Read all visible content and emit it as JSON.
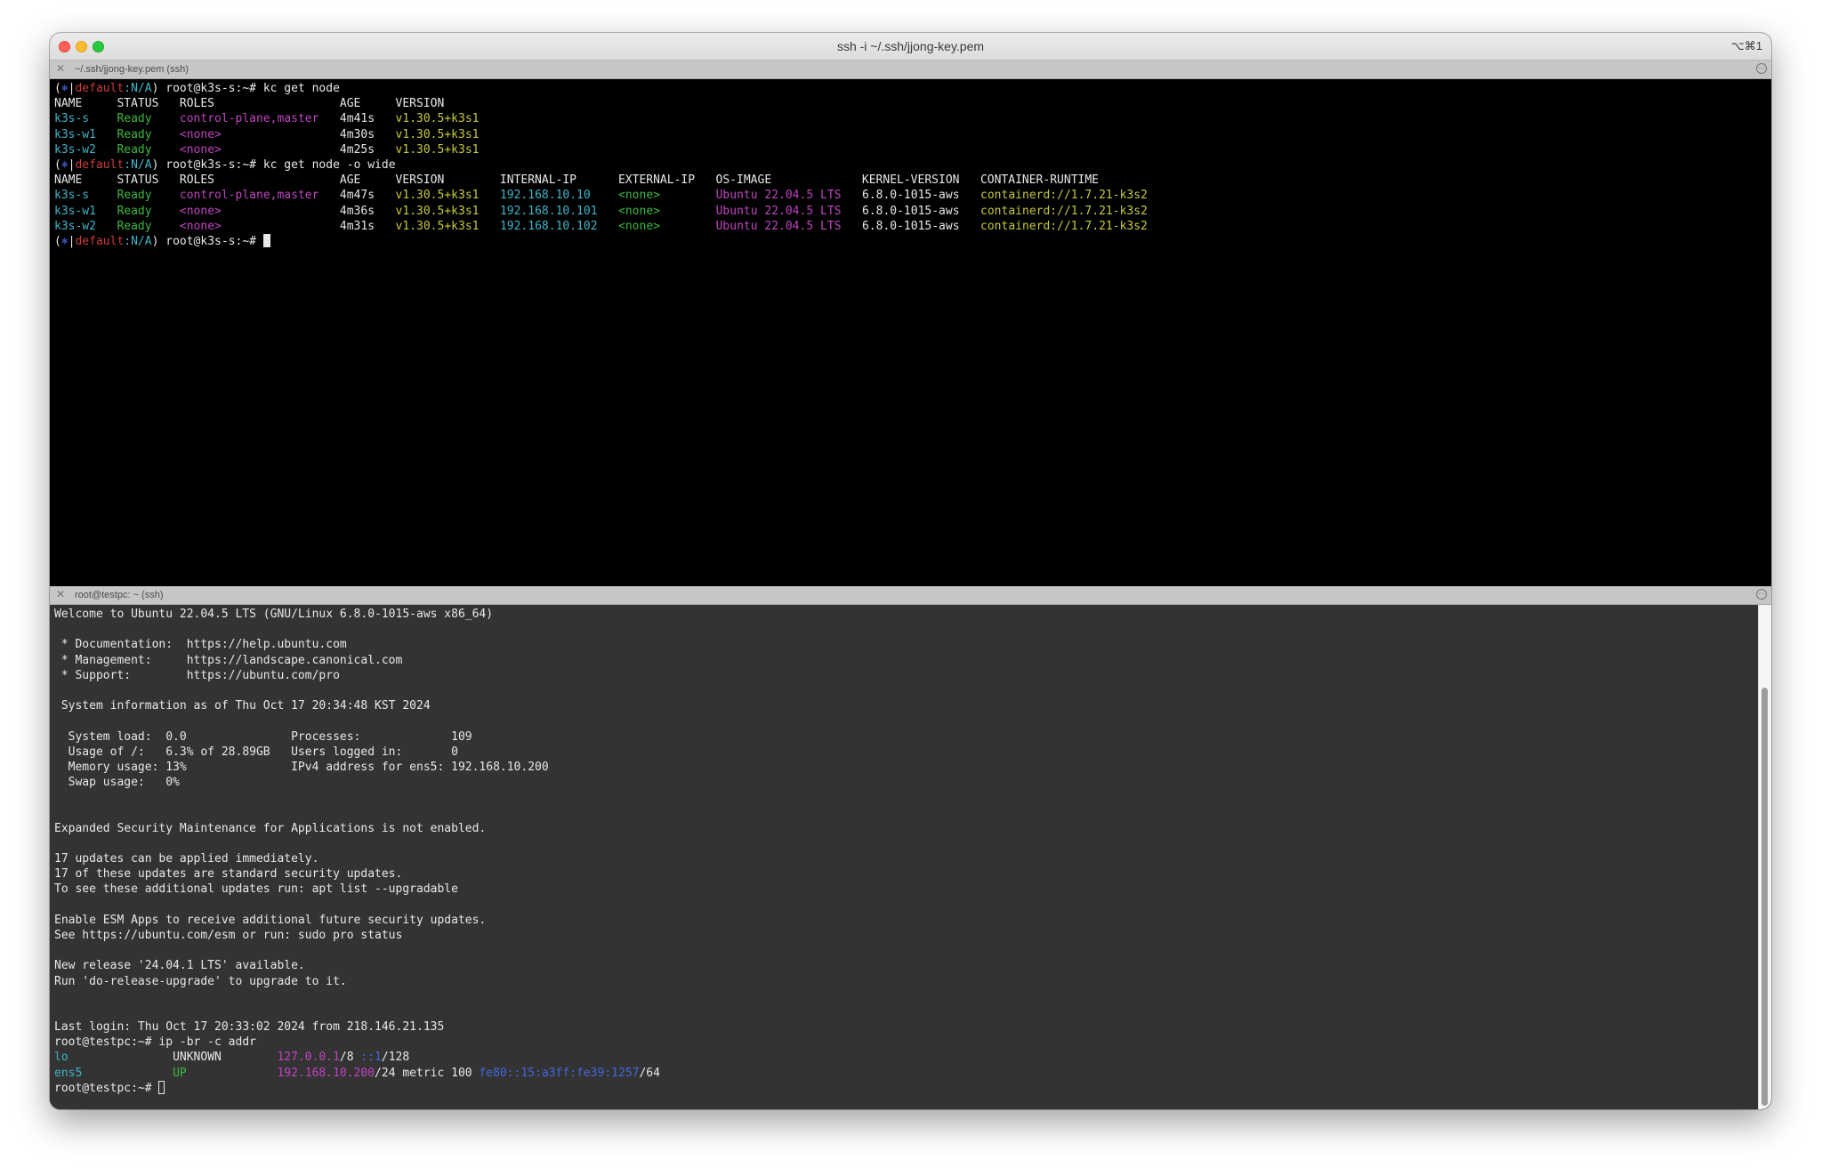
{
  "window": {
    "title": "ssh -i ~/.ssh/jjong-key.pem",
    "shortcut": "⌥⌘1"
  },
  "icons": [
    "close-icon",
    "pane-menu-icon"
  ],
  "colors": {
    "cyan": "#40b4c8",
    "green": "#3db83d",
    "magenta": "#c044c0",
    "yellow": "#c8c83c",
    "red": "#cc3b3b",
    "blue": "#4466dd",
    "white": "#e8e8e8"
  },
  "top_pane": {
    "title": "~/.ssh/jjong-key.pem (ssh)",
    "lines": [
      [
        {
          "t": "(",
          "c": "white"
        },
        {
          "t": "⎈",
          "c": "blue"
        },
        {
          "t": "|",
          "c": "white"
        },
        {
          "t": "default",
          "c": "red"
        },
        {
          "t": ":N/A",
          "c": "cyan"
        },
        {
          "t": ") root@k3s-s:~# kc get node",
          "c": "white"
        }
      ],
      [
        {
          "t": "NAME     STATUS   ROLES                  AGE     VERSION",
          "c": "white"
        }
      ],
      [
        {
          "t": "k3s-s    ",
          "c": "cyan"
        },
        {
          "t": "Ready    ",
          "c": "green"
        },
        {
          "t": "control-plane,master   ",
          "c": "magenta"
        },
        {
          "t": "4m41s   ",
          "c": "white"
        },
        {
          "t": "v1.30.5+k3s1",
          "c": "yellow"
        }
      ],
      [
        {
          "t": "k3s-w1   ",
          "c": "cyan"
        },
        {
          "t": "Ready    ",
          "c": "green"
        },
        {
          "t": "<none>                 ",
          "c": "magenta"
        },
        {
          "t": "4m30s   ",
          "c": "white"
        },
        {
          "t": "v1.30.5+k3s1",
          "c": "yellow"
        }
      ],
      [
        {
          "t": "k3s-w2   ",
          "c": "cyan"
        },
        {
          "t": "Ready    ",
          "c": "green"
        },
        {
          "t": "<none>                 ",
          "c": "magenta"
        },
        {
          "t": "4m25s   ",
          "c": "white"
        },
        {
          "t": "v1.30.5+k3s1",
          "c": "yellow"
        }
      ],
      [
        {
          "t": "(",
          "c": "white"
        },
        {
          "t": "⎈",
          "c": "blue"
        },
        {
          "t": "|",
          "c": "white"
        },
        {
          "t": "default",
          "c": "red"
        },
        {
          "t": ":N/A",
          "c": "cyan"
        },
        {
          "t": ") root@k3s-s:~# kc get node -o wide",
          "c": "white"
        }
      ],
      [
        {
          "t": "NAME     STATUS   ROLES                  AGE     VERSION        INTERNAL-IP      EXTERNAL-IP   OS-IMAGE             KERNEL-VERSION   CONTAINER-RUNTIME",
          "c": "white"
        }
      ],
      [
        {
          "t": "k3s-s    ",
          "c": "cyan"
        },
        {
          "t": "Ready    ",
          "c": "green"
        },
        {
          "t": "control-plane,master   ",
          "c": "magenta"
        },
        {
          "t": "4m47s   ",
          "c": "white"
        },
        {
          "t": "v1.30.5+k3s1   ",
          "c": "yellow"
        },
        {
          "t": "192.168.10.10    ",
          "c": "cyan"
        },
        {
          "t": "<none>        ",
          "c": "green"
        },
        {
          "t": "Ubuntu 22.04.5 LTS   ",
          "c": "magenta"
        },
        {
          "t": "6.8.0-1015-aws   ",
          "c": "white"
        },
        {
          "t": "containerd://1.7.21-k3s2",
          "c": "yellow"
        }
      ],
      [
        {
          "t": "k3s-w1   ",
          "c": "cyan"
        },
        {
          "t": "Ready    ",
          "c": "green"
        },
        {
          "t": "<none>                 ",
          "c": "magenta"
        },
        {
          "t": "4m36s   ",
          "c": "white"
        },
        {
          "t": "v1.30.5+k3s1   ",
          "c": "yellow"
        },
        {
          "t": "192.168.10.101   ",
          "c": "cyan"
        },
        {
          "t": "<none>        ",
          "c": "green"
        },
        {
          "t": "Ubuntu 22.04.5 LTS   ",
          "c": "magenta"
        },
        {
          "t": "6.8.0-1015-aws   ",
          "c": "white"
        },
        {
          "t": "containerd://1.7.21-k3s2",
          "c": "yellow"
        }
      ],
      [
        {
          "t": "k3s-w2   ",
          "c": "cyan"
        },
        {
          "t": "Ready    ",
          "c": "green"
        },
        {
          "t": "<none>                 ",
          "c": "magenta"
        },
        {
          "t": "4m31s   ",
          "c": "white"
        },
        {
          "t": "v1.30.5+k3s1   ",
          "c": "yellow"
        },
        {
          "t": "192.168.10.102   ",
          "c": "cyan"
        },
        {
          "t": "<none>        ",
          "c": "green"
        },
        {
          "t": "Ubuntu 22.04.5 LTS   ",
          "c": "magenta"
        },
        {
          "t": "6.8.0-1015-aws   ",
          "c": "white"
        },
        {
          "t": "containerd://1.7.21-k3s2",
          "c": "yellow"
        }
      ],
      [
        {
          "t": "(",
          "c": "white"
        },
        {
          "t": "⎈",
          "c": "blue"
        },
        {
          "t": "|",
          "c": "white"
        },
        {
          "t": "default",
          "c": "red"
        },
        {
          "t": ":N/A",
          "c": "cyan"
        },
        {
          "t": ") root@k3s-s:~# ",
          "c": "white"
        }
      ]
    ]
  },
  "bottom_pane": {
    "title": "root@testpc: ~ (ssh)",
    "lines": [
      [
        {
          "t": "Welcome to Ubuntu 22.04.5 LTS (GNU/Linux 6.8.0-1015-aws x86_64)",
          "c": "white"
        }
      ],
      [],
      [
        {
          "t": " * Documentation:  https://help.ubuntu.com",
          "c": "white"
        }
      ],
      [
        {
          "t": " * Management:     https://landscape.canonical.com",
          "c": "white"
        }
      ],
      [
        {
          "t": " * Support:        https://ubuntu.com/pro",
          "c": "white"
        }
      ],
      [],
      [
        {
          "t": " System information as of Thu Oct 17 20:34:48 KST 2024",
          "c": "white"
        }
      ],
      [],
      [
        {
          "t": "  System load:  0.0               Processes:             109",
          "c": "white"
        }
      ],
      [
        {
          "t": "  Usage of /:   6.3% of 28.89GB   Users logged in:       0",
          "c": "white"
        }
      ],
      [
        {
          "t": "  Memory usage: 13%               IPv4 address for ens5: 192.168.10.200",
          "c": "white"
        }
      ],
      [
        {
          "t": "  Swap usage:   0%",
          "c": "white"
        }
      ],
      [],
      [],
      [
        {
          "t": "Expanded Security Maintenance for Applications is not enabled.",
          "c": "white"
        }
      ],
      [],
      [
        {
          "t": "17 updates can be applied immediately.",
          "c": "white"
        }
      ],
      [
        {
          "t": "17 of these updates are standard security updates.",
          "c": "white"
        }
      ],
      [
        {
          "t": "To see these additional updates run: apt list --upgradable",
          "c": "white"
        }
      ],
      [],
      [
        {
          "t": "Enable ESM Apps to receive additional future security updates.",
          "c": "white"
        }
      ],
      [
        {
          "t": "See https://ubuntu.com/esm or run: sudo pro status",
          "c": "white"
        }
      ],
      [],
      [
        {
          "t": "New release '24.04.1 LTS' available.",
          "c": "white"
        }
      ],
      [
        {
          "t": "Run 'do-release-upgrade' to upgrade to it.",
          "c": "white"
        }
      ],
      [],
      [],
      [
        {
          "t": "Last login: Thu Oct 17 20:33:02 2024 from 218.146.21.135",
          "c": "white"
        }
      ],
      [
        {
          "t": "root@testpc:~# ip -br -c addr",
          "c": "white"
        }
      ],
      [
        {
          "t": "lo               ",
          "c": "cyan"
        },
        {
          "t": "UNKNOWN        ",
          "c": "white"
        },
        {
          "t": "127.0.0.1",
          "c": "magenta"
        },
        {
          "t": "/8 ",
          "c": "white"
        },
        {
          "t": "::1",
          "c": "blue"
        },
        {
          "t": "/128",
          "c": "white"
        }
      ],
      [
        {
          "t": "ens5             ",
          "c": "cyan"
        },
        {
          "t": "UP             ",
          "c": "green"
        },
        {
          "t": "192.168.10.200",
          "c": "magenta"
        },
        {
          "t": "/24 metric 100 ",
          "c": "white"
        },
        {
          "t": "fe80::15:a3ff:fe39:1257",
          "c": "blue"
        },
        {
          "t": "/64",
          "c": "white"
        }
      ],
      [
        {
          "t": "root@testpc:~# ",
          "c": "white"
        }
      ]
    ]
  }
}
